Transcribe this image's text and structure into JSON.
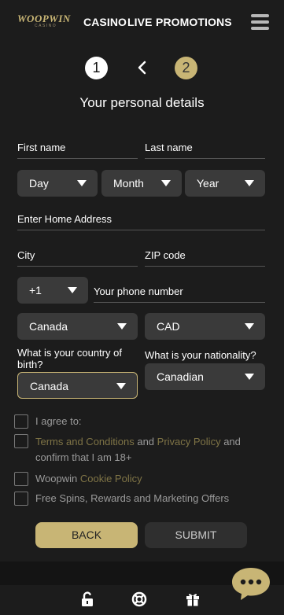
{
  "header": {
    "logo_text": "WOOPWIN",
    "logo_sub": "CASINO",
    "nav": [
      "CASINO",
      "LIVE",
      "PROMOTIONS"
    ]
  },
  "steps": {
    "step1": "1",
    "step2": "2"
  },
  "form": {
    "title": "Your personal details",
    "first_name": "First name",
    "last_name": "Last name",
    "day": "Day",
    "month": "Month",
    "year": "Year",
    "home_address": "Enter Home Address",
    "city": "City",
    "zip": "ZIP code",
    "phone_code": "+1",
    "phone_placeholder": "Your phone number",
    "country": "Canada",
    "currency": "CAD",
    "birth_country_label": "What is your country of birth?",
    "birth_country": "Canada",
    "nationality_label": "What is your nationality?",
    "nationality": "Canadian"
  },
  "consents": {
    "agree": "I agree to:",
    "terms_link": "Terms and Conditions",
    "and1": " and ",
    "privacy_link": "Privacy Policy",
    "and2": " and",
    "confirm": "confirm that I am 18+",
    "woopwin": "Woopwin ",
    "cookie_link": "Cookie Policy",
    "marketing": "Free Spins, Rewards and Marketing Offers"
  },
  "buttons": {
    "back": "BACK",
    "submit": "SUBMIT"
  },
  "footer": {
    "icons": [
      "unlock-icon",
      "lifebuoy-icon",
      "gift-icon",
      "chat-icon"
    ]
  },
  "colors": {
    "gold": "#c8b575",
    "background": "#1c1c1c",
    "select_bg": "#3a3a3a",
    "link": "#7f7446"
  }
}
